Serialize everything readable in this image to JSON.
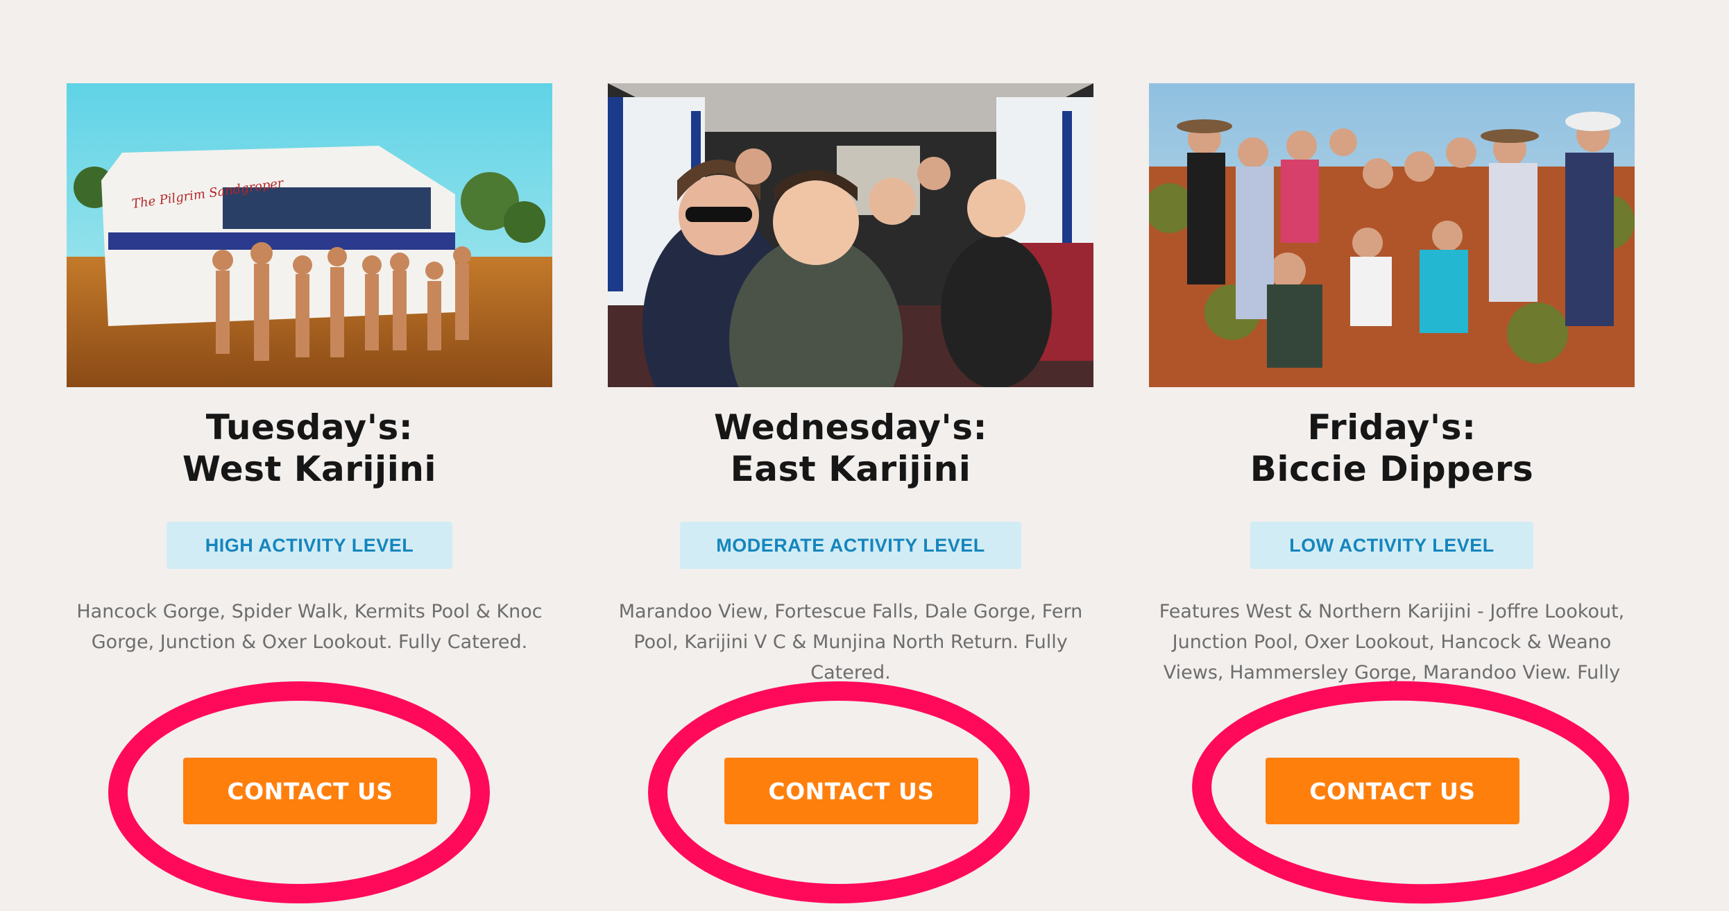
{
  "tours": [
    {
      "title_line1": "Tuesday's:",
      "title_line2": "West Karijini",
      "activity_level": "HIGH ACTIVITY LEVEL",
      "description": "Hancock Gorge, Spider Walk, Kermits Pool & Knoc Gorge, Junction & Oxer Lookout. Fully Catered.",
      "button_label": "CONTACT US",
      "photo": {
        "subject": "group-with-tour-bus-photo",
        "bus_sign": "The Pilgrim Sandgroper"
      }
    },
    {
      "title_line1": "Wednesday's:",
      "title_line2": "East Karijini",
      "activity_level": "MODERATE ACTIVITY LEVEL",
      "description": "Marandoo View, Fortescue Falls, Dale Gorge, Fern Pool, Karijini V C & Munjina North Return. Fully Catered.",
      "button_label": "CONTACT US",
      "photo": {
        "subject": "passengers-inside-bus-photo"
      }
    },
    {
      "title_line1": "Friday's:",
      "title_line2": "Biccie Dippers",
      "activity_level": "LOW ACTIVITY LEVEL",
      "description": "Features West & Northern Karijini - Joffre Lookout, Junction Pool, Oxer Lookout, Hancock & Weano Views, Hammersley Gorge, Marandoo View. Fully Catered.",
      "button_label": "CONTACT US",
      "photo": {
        "subject": "outback-group-photo"
      }
    }
  ],
  "colors": {
    "page_background": "#f2efed",
    "title": "#161616",
    "badge_background": "#d2ecf5",
    "badge_text": "#1585bd",
    "description_text": "#6d6d6d",
    "button_background": "#ff7f0d",
    "button_text": "#ffffff",
    "highlight_ring": "#ff0a5b"
  }
}
